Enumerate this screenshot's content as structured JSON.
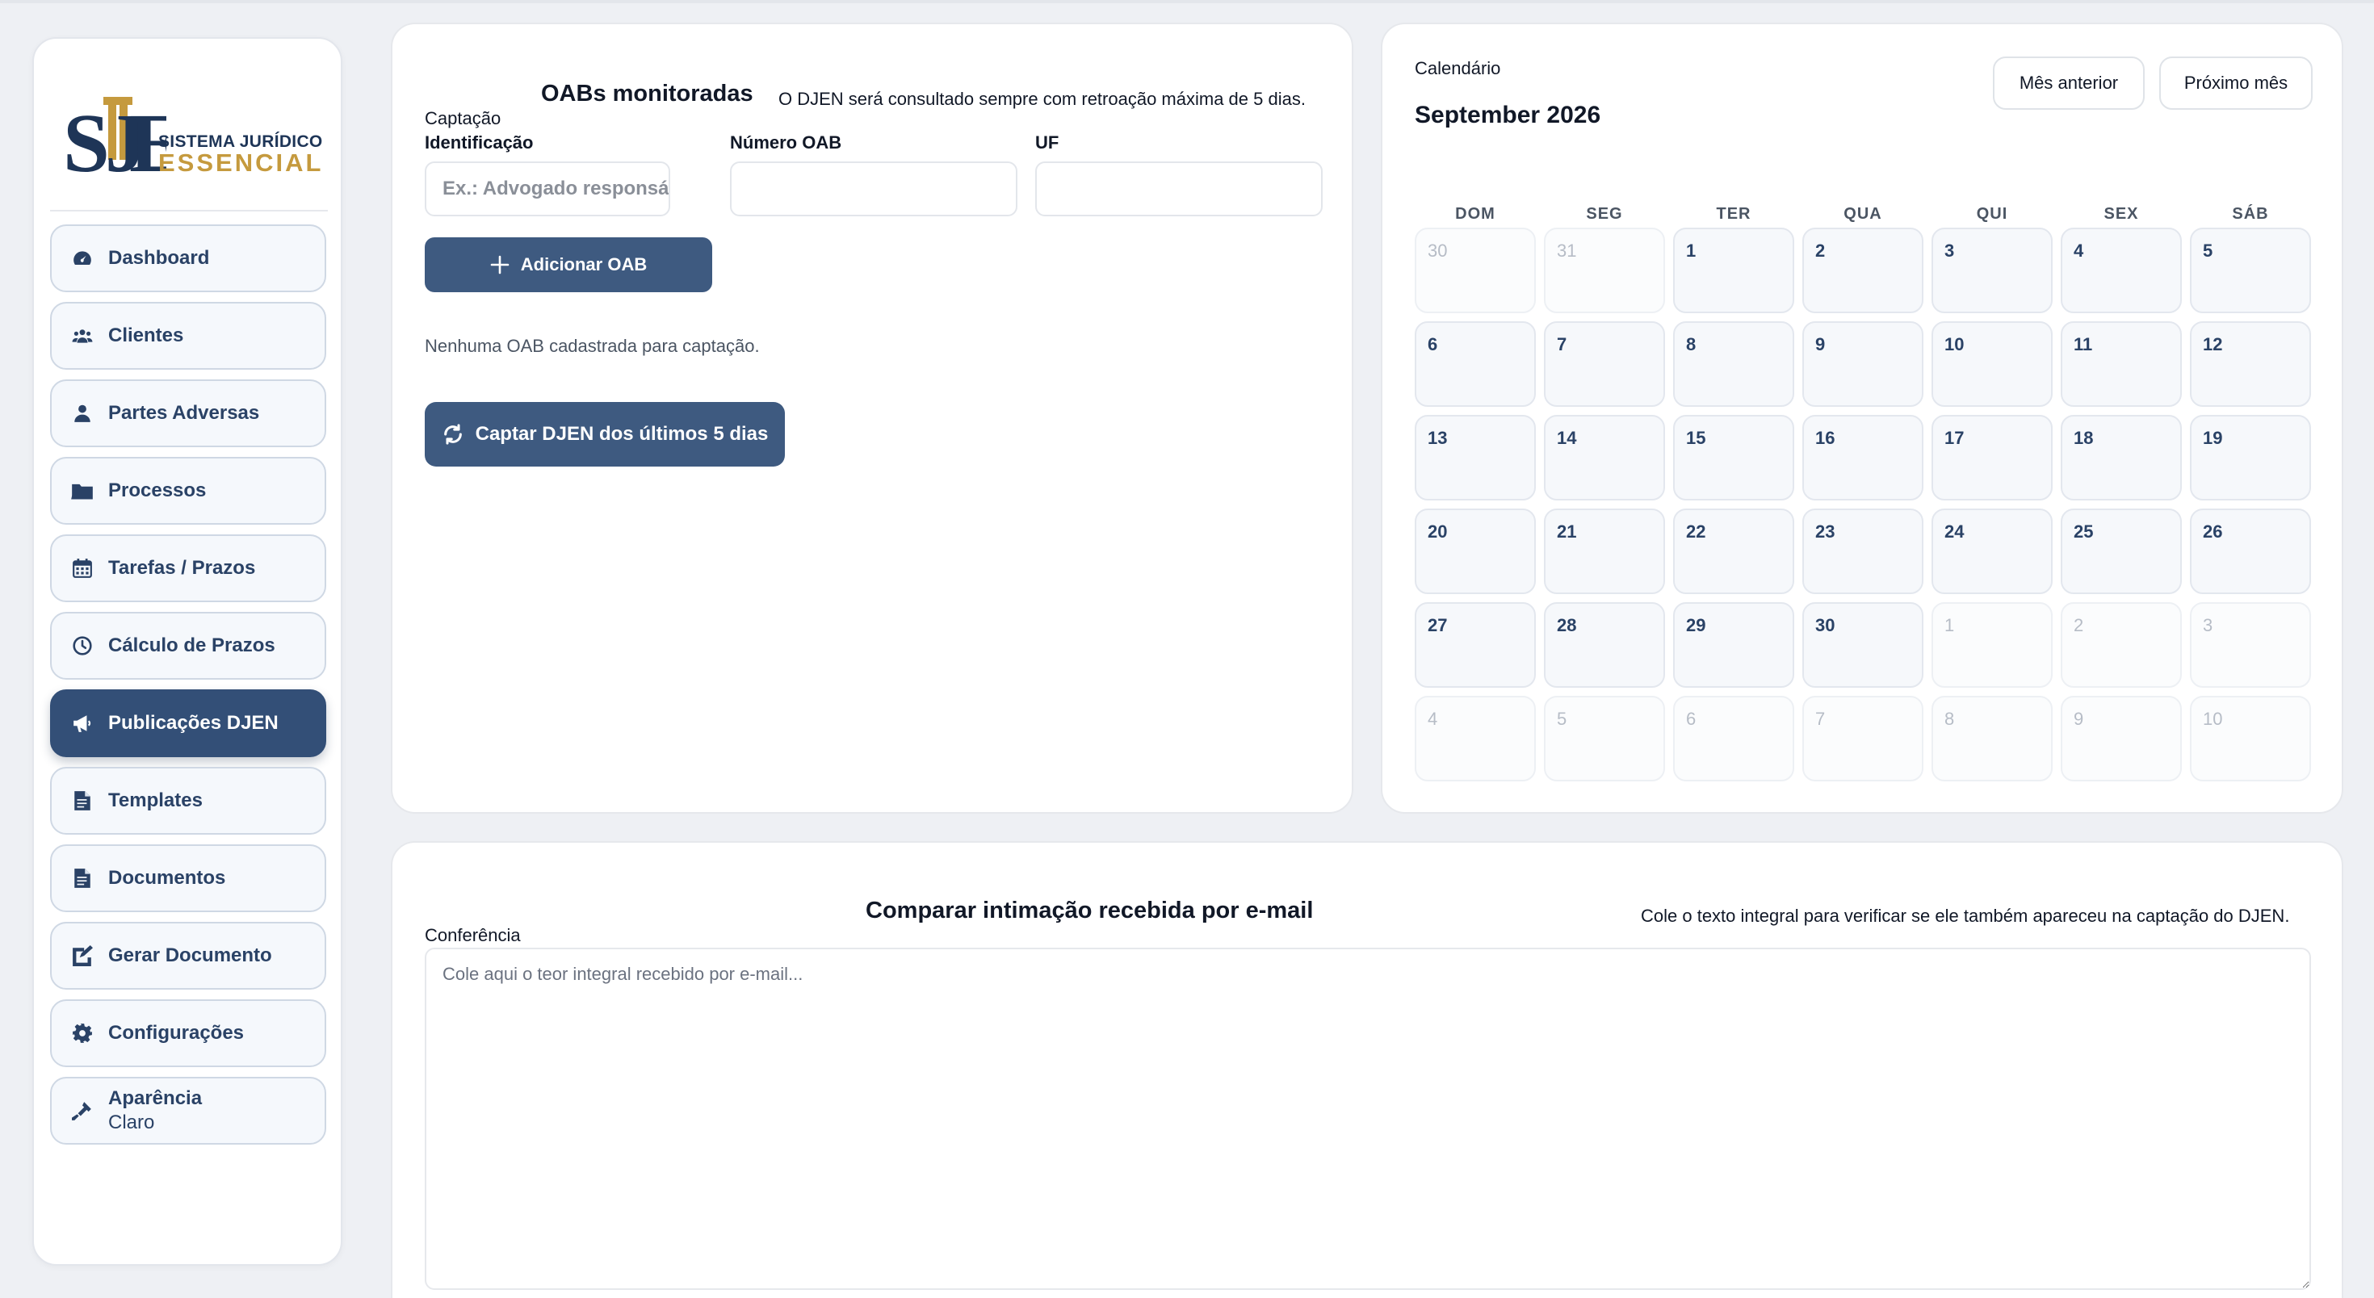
{
  "brand": {
    "line1": "SISTEMA JURÍDICO",
    "line2": "ESSENCIAL",
    "colors": {
      "navy": "#1e3557",
      "gold": "#c59a3e"
    }
  },
  "sidebar": {
    "items": [
      {
        "label": "Dashboard",
        "icon": "dashboard-icon",
        "active": false
      },
      {
        "label": "Clientes",
        "icon": "users-icon",
        "active": false
      },
      {
        "label": "Partes Adversas",
        "icon": "user-icon",
        "active": false
      },
      {
        "label": "Processos",
        "icon": "folder-icon",
        "active": false
      },
      {
        "label": "Tarefas / Prazos",
        "icon": "calendar-icon",
        "active": false
      },
      {
        "label": "Cálculo de Prazos",
        "icon": "clock-icon",
        "active": false
      },
      {
        "label": "Publicações DJEN",
        "icon": "megaphone-icon",
        "active": true
      },
      {
        "label": "Templates",
        "icon": "document-icon",
        "active": false
      },
      {
        "label": "Documentos",
        "icon": "document-icon",
        "active": false
      },
      {
        "label": "Gerar Documento",
        "icon": "edit-document-icon",
        "active": false
      },
      {
        "label": "Configurações",
        "icon": "gear-icon",
        "active": false
      },
      {
        "label": "Aparência",
        "sublabel": "Claro",
        "icon": "brush-icon",
        "active": false
      }
    ],
    "colors": {
      "active_bg": "#334f77",
      "item_text": "#2a4266"
    }
  },
  "captacao": {
    "section_label": "Captação",
    "title": "OABs monitoradas",
    "note": "O DJEN será consultado sempre com retroação máxima de 5 dias.",
    "fields": {
      "identificacao": {
        "label": "Identificação",
        "placeholder": "Ex.: Advogado responsável",
        "value": ""
      },
      "numero_oab": {
        "label": "Número OAB",
        "placeholder": "",
        "value": ""
      },
      "uf": {
        "label": "UF",
        "placeholder": "",
        "value": ""
      }
    },
    "add_button": "Adicionar OAB",
    "empty_text": "Nenhuma OAB cadastrada para captação.",
    "capture_button": "Captar DJEN dos últimos 5 dias"
  },
  "calendar": {
    "section_label": "Calendário",
    "month_title": "September 2026",
    "prev_button": "Mês anterior",
    "next_button": "Próximo mês",
    "weekdays": [
      "DOM",
      "SEG",
      "TER",
      "QUA",
      "QUI",
      "SEX",
      "SÁB"
    ],
    "days": [
      {
        "n": "30",
        "cur": false
      },
      {
        "n": "31",
        "cur": false
      },
      {
        "n": "1",
        "cur": true
      },
      {
        "n": "2",
        "cur": true
      },
      {
        "n": "3",
        "cur": true
      },
      {
        "n": "4",
        "cur": true
      },
      {
        "n": "5",
        "cur": true
      },
      {
        "n": "6",
        "cur": true
      },
      {
        "n": "7",
        "cur": true
      },
      {
        "n": "8",
        "cur": true
      },
      {
        "n": "9",
        "cur": true
      },
      {
        "n": "10",
        "cur": true
      },
      {
        "n": "11",
        "cur": true
      },
      {
        "n": "12",
        "cur": true
      },
      {
        "n": "13",
        "cur": true
      },
      {
        "n": "14",
        "cur": true
      },
      {
        "n": "15",
        "cur": true
      },
      {
        "n": "16",
        "cur": true
      },
      {
        "n": "17",
        "cur": true
      },
      {
        "n": "18",
        "cur": true
      },
      {
        "n": "19",
        "cur": true
      },
      {
        "n": "20",
        "cur": true
      },
      {
        "n": "21",
        "cur": true
      },
      {
        "n": "22",
        "cur": true
      },
      {
        "n": "23",
        "cur": true
      },
      {
        "n": "24",
        "cur": true
      },
      {
        "n": "25",
        "cur": true
      },
      {
        "n": "26",
        "cur": true
      },
      {
        "n": "27",
        "cur": true
      },
      {
        "n": "28",
        "cur": true
      },
      {
        "n": "29",
        "cur": true
      },
      {
        "n": "30",
        "cur": true
      },
      {
        "n": "1",
        "cur": false
      },
      {
        "n": "2",
        "cur": false
      },
      {
        "n": "3",
        "cur": false
      },
      {
        "n": "4",
        "cur": false
      },
      {
        "n": "5",
        "cur": false
      },
      {
        "n": "6",
        "cur": false
      },
      {
        "n": "7",
        "cur": false
      },
      {
        "n": "8",
        "cur": false
      },
      {
        "n": "9",
        "cur": false
      },
      {
        "n": "10",
        "cur": false
      }
    ]
  },
  "conferencia": {
    "section_label": "Conferência",
    "title": "Comparar intimação recebida por e-mail",
    "note": "Cole o texto integral para verificar se ele também apareceu na captação do DJEN.",
    "placeholder": "Cole aqui o teor integral recebido por e-mail...",
    "value": ""
  }
}
